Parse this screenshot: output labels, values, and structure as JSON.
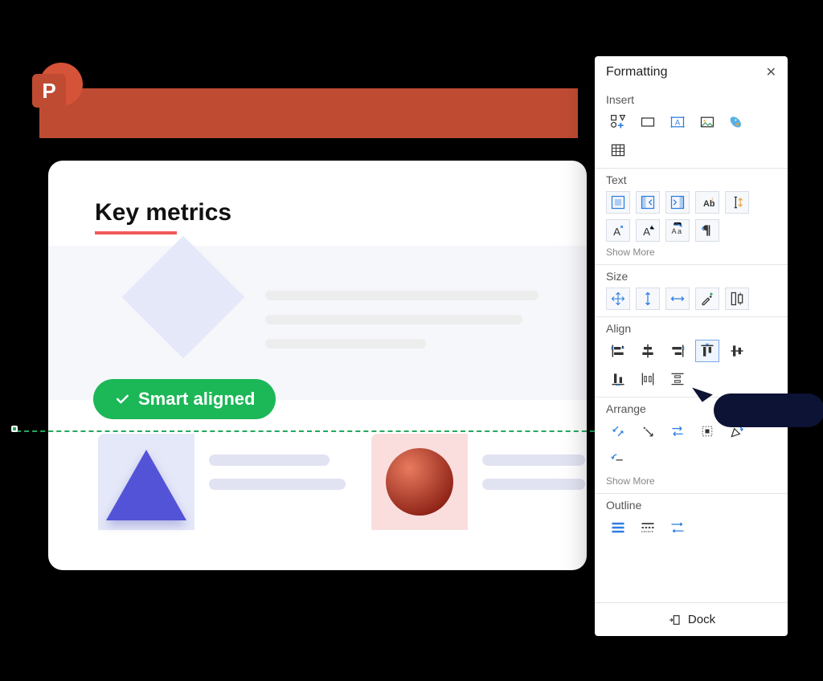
{
  "app": {
    "name": "PowerPoint",
    "logo_letter": "P"
  },
  "slide": {
    "title": "Key metrics",
    "badge": "Smart aligned"
  },
  "panel": {
    "title": "Formatting",
    "dock_label": "Dock",
    "close_glyph": "✕",
    "sections": {
      "insert": {
        "label": "Insert"
      },
      "text": {
        "label": "Text",
        "show_more": "Show More"
      },
      "size": {
        "label": "Size"
      },
      "align": {
        "label": "Align"
      },
      "arrange": {
        "label": "Arrange",
        "show_more": "Show More"
      },
      "outline": {
        "label": "Outline"
      }
    }
  }
}
